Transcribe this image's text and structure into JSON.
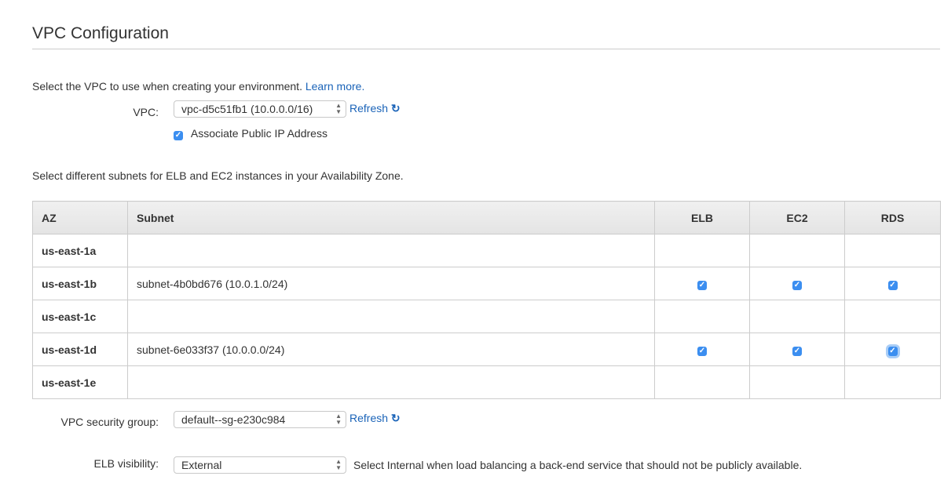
{
  "title": "VPC Configuration",
  "intro": "Select the VPC to use when creating your environment.",
  "learn_more": "Learn more.",
  "vpc": {
    "label": "VPC:",
    "value": "vpc-d5c51fb1 (10.0.0.0/16)",
    "refresh": "Refresh"
  },
  "associate_ip": {
    "label": "Associate Public IP Address",
    "checked": true
  },
  "subnet_intro": "Select different subnets for ELB and EC2 instances in your Availability Zone.",
  "table": {
    "headers": [
      "AZ",
      "Subnet",
      "ELB",
      "EC2",
      "RDS"
    ],
    "rows": [
      {
        "az": "us-east-1a",
        "subnet": "",
        "elb": false,
        "ec2": false,
        "rds": false
      },
      {
        "az": "us-east-1b",
        "subnet": "subnet-4b0bd676 (10.0.1.0/24)",
        "elb": true,
        "ec2": true,
        "rds": true
      },
      {
        "az": "us-east-1c",
        "subnet": "",
        "elb": false,
        "ec2": false,
        "rds": false
      },
      {
        "az": "us-east-1d",
        "subnet": "subnet-6e033f37 (10.0.0.0/24)",
        "elb": true,
        "ec2": true,
        "rds": true
      },
      {
        "az": "us-east-1e",
        "subnet": "",
        "elb": false,
        "ec2": false,
        "rds": false
      }
    ]
  },
  "security_group": {
    "label": "VPC security group:",
    "value": "default--sg-e230c984",
    "refresh": "Refresh"
  },
  "elb_visibility": {
    "label": "ELB visibility:",
    "value": "External",
    "help": "Select Internal when load balancing a back-end service that should not be publicly available."
  }
}
